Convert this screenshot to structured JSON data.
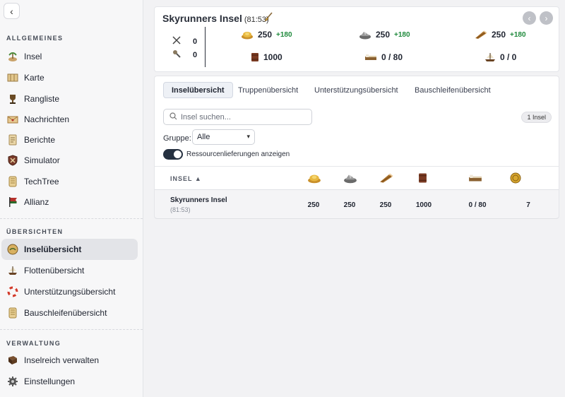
{
  "sidebar": {
    "sections": [
      {
        "label": "ALLGEMEINES",
        "items": [
          {
            "label": "Insel",
            "icon": "island-icon"
          },
          {
            "label": "Karte",
            "icon": "map-icon"
          },
          {
            "label": "Rangliste",
            "icon": "trophy-icon"
          },
          {
            "label": "Nachrichten",
            "icon": "messages-icon"
          },
          {
            "label": "Berichte",
            "icon": "reports-icon"
          },
          {
            "label": "Simulator",
            "icon": "simulator-icon"
          },
          {
            "label": "TechTree",
            "icon": "techtree-icon"
          },
          {
            "label": "Allianz",
            "icon": "alliance-flag-icon"
          }
        ]
      },
      {
        "label": "ÜBERSICHTEN",
        "items": [
          {
            "label": "Inselübersicht",
            "icon": "island-overview-icon",
            "active": true
          },
          {
            "label": "Flottenübersicht",
            "icon": "fleet-icon"
          },
          {
            "label": "Unterstützungsübersicht",
            "icon": "lifebuoy-icon"
          },
          {
            "label": "Bauschleifenübersicht",
            "icon": "build-queue-icon"
          }
        ]
      },
      {
        "label": "VERWALTUNG",
        "items": [
          {
            "label": "Inselreich verwalten",
            "icon": "book-icon"
          },
          {
            "label": "Einstellungen",
            "icon": "settings-icon"
          }
        ]
      }
    ]
  },
  "island": {
    "name": "Skyrunners Insel",
    "coords": "(81:53)",
    "units": [
      {
        "icon": "swords-icon",
        "value": "0"
      },
      {
        "icon": "tools-icon",
        "value": "0"
      }
    ],
    "resources": [
      {
        "icon": "gold-icon",
        "value": "250",
        "rate": "+180"
      },
      {
        "icon": "stone-icon",
        "value": "250",
        "rate": "+180"
      },
      {
        "icon": "wood-icon",
        "value": "250",
        "rate": "+180"
      },
      {
        "icon": "storage-icon",
        "value": "1000"
      },
      {
        "icon": "bed-icon",
        "value": "0 / 80"
      },
      {
        "icon": "ship-icon",
        "value": "0 / 0"
      }
    ]
  },
  "tabs": [
    {
      "label": "Inselübersicht",
      "active": true
    },
    {
      "label": "Truppenübersicht"
    },
    {
      "label": "Unterstützungsübersicht"
    },
    {
      "label": "Bauschleifenübersicht"
    }
  ],
  "search": {
    "placeholder": "Insel suchen..."
  },
  "count_badge": "1 Insel",
  "group": {
    "label": "Gruppe:",
    "selected": "Alle"
  },
  "toggle": {
    "label": "Ressourcenlieferungen anzeigen",
    "on": true
  },
  "table": {
    "name_header": "INSEL ▲",
    "columns": [
      "gold-icon",
      "stone-icon",
      "wood-icon",
      "storage-icon",
      "bed-icon",
      "coin-icon"
    ],
    "rows": [
      {
        "name": "Skyrunners Insel",
        "coords": "(81:53)",
        "values": [
          "250",
          "250",
          "250",
          "1000",
          "0 / 80",
          "7"
        ]
      }
    ]
  },
  "colors": {
    "accent_green": "#1f8a3c",
    "toggle_dark": "#253040",
    "active_bg": "#e3e4e8"
  }
}
